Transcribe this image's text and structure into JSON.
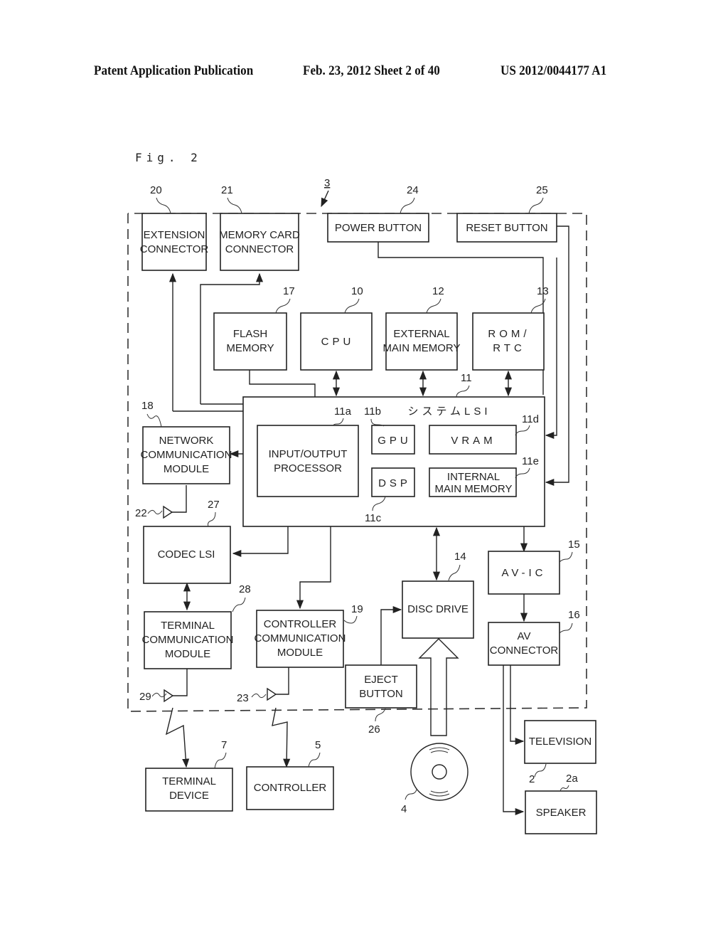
{
  "header": {
    "publication": "Patent Application Publication",
    "date_sheet": "Feb. 23, 2012   Sheet 2 of 40",
    "patent_number": "US 2012/0044177 A1"
  },
  "figure_label": "Fig. 2",
  "diagram": {
    "enclosure_ref": "3",
    "blocks": {
      "extension_connector": {
        "ref": "20",
        "lines": [
          "EXTENSION",
          "CONNECTOR"
        ]
      },
      "memory_card_connector": {
        "ref": "21",
        "lines": [
          "MEMORY CARD",
          "CONNECTOR"
        ]
      },
      "power_button": {
        "ref": "24",
        "lines": [
          "POWER BUTTON"
        ]
      },
      "reset_button": {
        "ref": "25",
        "lines": [
          "RESET BUTTON"
        ]
      },
      "flash_memory": {
        "ref": "17",
        "lines": [
          "FLASH",
          "MEMORY"
        ]
      },
      "cpu": {
        "ref": "10",
        "lines": [
          "CPU"
        ]
      },
      "external_main_memory": {
        "ref": "12",
        "lines": [
          "EXTERNAL",
          "MAIN MEMORY"
        ]
      },
      "rom_rtc": {
        "ref": "13",
        "lines": [
          "ROM/",
          "RTC"
        ]
      },
      "system_lsi": {
        "ref": "11",
        "lines": [
          "システムLSI"
        ]
      },
      "io_processor": {
        "ref": "11a",
        "lines": [
          "INPUT/OUTPUT",
          "PROCESSOR"
        ]
      },
      "gpu": {
        "ref": "11b",
        "lines": [
          "GPU"
        ]
      },
      "dsp": {
        "ref": "11c",
        "lines": [
          "DSP"
        ]
      },
      "vram": {
        "ref": "11d",
        "lines": [
          "VRAM"
        ]
      },
      "internal_main_memory": {
        "ref": "11e",
        "lines": [
          "INTERNAL",
          "MAIN MEMORY"
        ]
      },
      "network_module": {
        "ref": "18",
        "lines": [
          "NETWORK",
          "COMMUNICATION",
          "MODULE"
        ]
      },
      "codec_lsi": {
        "ref": "27",
        "lines": [
          "CODEC LSI"
        ]
      },
      "terminal_comm_module": {
        "ref": "28",
        "lines": [
          "TERMINAL",
          "COMMUNICATION",
          "MODULE"
        ]
      },
      "controller_comm_module": {
        "ref": "19",
        "lines": [
          "CONTROLLER",
          "COMMUNICATION",
          "MODULE"
        ]
      },
      "disc_drive": {
        "ref": "14",
        "lines": [
          "DISC DRIVE"
        ]
      },
      "eject_button": {
        "ref": "26",
        "lines": [
          "EJECT",
          "BUTTON"
        ]
      },
      "av_ic": {
        "ref": "15",
        "lines": [
          "AV-IC"
        ]
      },
      "av_connector": {
        "ref": "16",
        "lines": [
          "AV",
          "CONNECTOR"
        ]
      },
      "television": {
        "ref": "2",
        "lines": [
          "TELEVISION"
        ]
      },
      "speaker": {
        "ref": "2a",
        "lines": [
          "SPEAKER"
        ]
      },
      "terminal_device": {
        "ref": "7",
        "lines": [
          "TERMINAL",
          "DEVICE"
        ]
      },
      "controller": {
        "ref": "5",
        "lines": [
          "CONTROLLER"
        ]
      }
    },
    "antennas": {
      "network": "22",
      "terminal": "29",
      "controller": "23"
    },
    "disc_ref": "4"
  }
}
